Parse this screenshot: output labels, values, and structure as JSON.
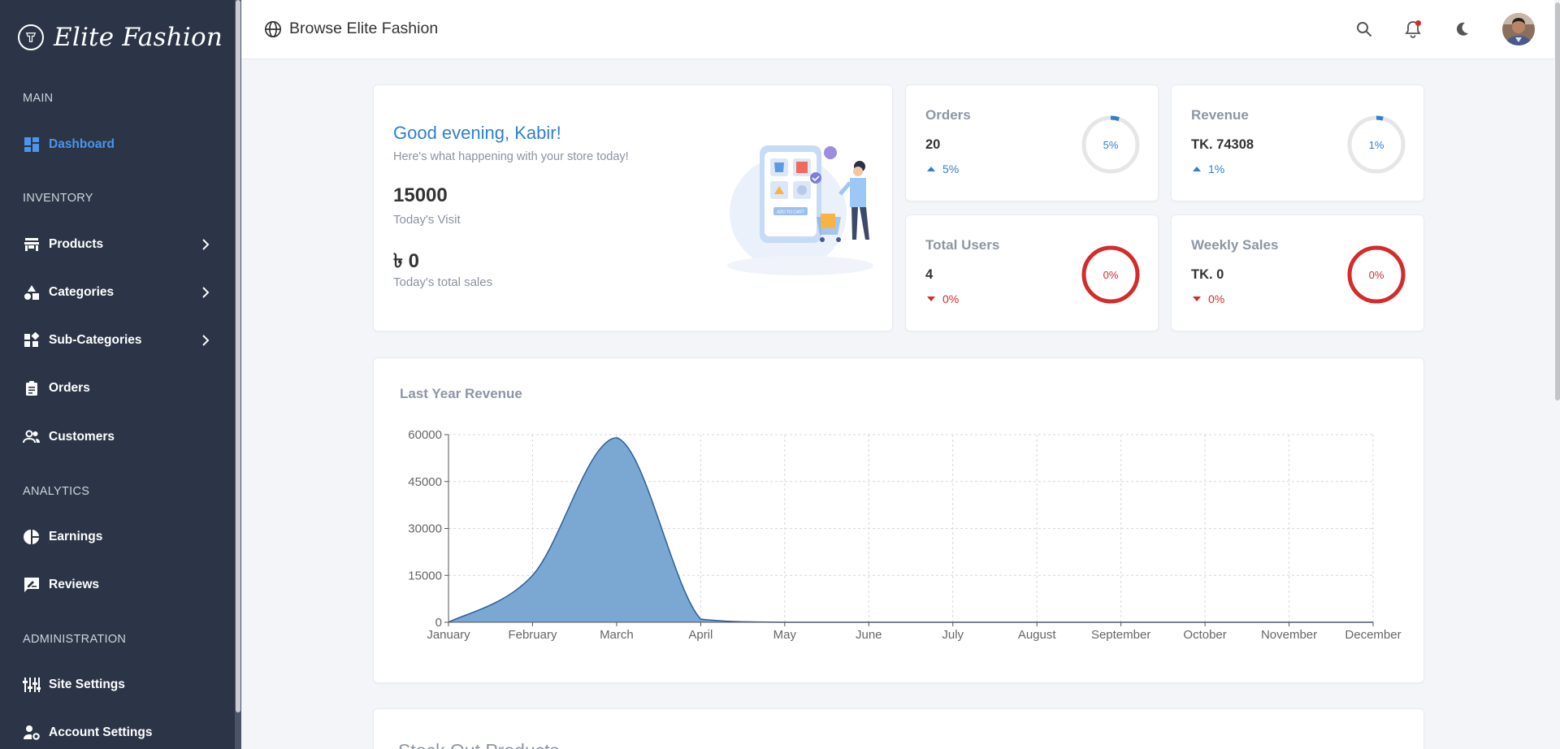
{
  "app": {
    "brand": "Elite Fashion"
  },
  "sidebar": {
    "sections": [
      "MAIN",
      "INVENTORY",
      "ANALYTICS",
      "ADMINISTRATION"
    ],
    "items": [
      {
        "label": "Dashboard",
        "icon": "dashboard-icon",
        "active": true
      },
      {
        "label": "Products",
        "icon": "store-icon"
      },
      {
        "label": "Categories",
        "icon": "shapes-icon"
      },
      {
        "label": "Sub-Categories",
        "icon": "widgets-icon"
      },
      {
        "label": "Orders",
        "icon": "clipboard-icon"
      },
      {
        "label": "Customers",
        "icon": "people-icon"
      },
      {
        "label": "Earnings",
        "icon": "pie-chart-icon"
      },
      {
        "label": "Reviews",
        "icon": "rate-review-icon"
      },
      {
        "label": "Site Settings",
        "icon": "sliders-icon"
      },
      {
        "label": "Account Settings",
        "icon": "manage-account-icon"
      }
    ]
  },
  "header": {
    "browse_label": "Browse Elite Fashion"
  },
  "welcome": {
    "greeting": "Good evening, Kabir!",
    "subtitle": "Here's what happening with your store today!",
    "visits": "15000",
    "visits_label": "Today's Visit",
    "sales": "৳ 0",
    "sales_label": "Today's total sales",
    "illustration_button": "ADD TO CART"
  },
  "stats": [
    {
      "title": "Orders",
      "value": "20",
      "change": "5%",
      "direction": "up",
      "ring_label": "5%",
      "ring_fraction": 0.05,
      "color": "#2f7fd0"
    },
    {
      "title": "Revenue",
      "value": "TK. 74308",
      "change": "1%",
      "direction": "up",
      "ring_label": "1%",
      "ring_fraction": 0.01,
      "color": "#2f7fd0"
    },
    {
      "title": "Total Users",
      "value": "4",
      "change": "0%",
      "direction": "down",
      "ring_label": "0%",
      "ring_fraction": 1.0,
      "color": "#d42b2b"
    },
    {
      "title": "Weekly Sales",
      "value": "TK. 0",
      "change": "0%",
      "direction": "down",
      "ring_label": "0%",
      "ring_fraction": 1.0,
      "color": "#d42b2b"
    }
  ],
  "chart_data": {
    "type": "area",
    "title": "Last Year Revenue",
    "categories": [
      "January",
      "February",
      "March",
      "April",
      "May",
      "June",
      "July",
      "August",
      "September",
      "October",
      "November",
      "December"
    ],
    "values": [
      0,
      15000,
      59000,
      1000,
      0,
      0,
      0,
      0,
      0,
      0,
      0,
      0
    ],
    "yticks": [
      0,
      15000,
      30000,
      45000,
      60000
    ],
    "ylim": [
      0,
      60000
    ],
    "grid": true,
    "fill_color": "#7aa8d2",
    "line_color": "#2f5f97"
  },
  "stock_out": {
    "title": "Stock Out Products"
  },
  "colors": {
    "sidebar_bg": "#2b3547",
    "accent": "#4d94ea",
    "danger": "#d42b2b"
  }
}
